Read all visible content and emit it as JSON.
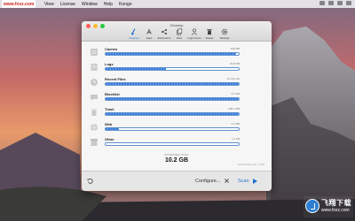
{
  "watermark_top": "www.fxxz.com",
  "menubar": {
    "items": [
      "View",
      "License",
      "Window",
      "Help",
      "Kongo"
    ]
  },
  "window": {
    "title": "Cleanup",
    "toolbar": [
      {
        "label": "Cleanup",
        "icon": "broom-icon",
        "active": true
      },
      {
        "label": "Apps",
        "icon": "apps-icon",
        "active": false
      },
      {
        "label": "Extensions",
        "icon": "share-icon",
        "active": false
      },
      {
        "label": "Files",
        "icon": "files-icon",
        "active": false
      },
      {
        "label": "Login Items",
        "icon": "person-icon",
        "active": false
      },
      {
        "label": "Eraser",
        "icon": "trash-icon",
        "active": false
      },
      {
        "label": "Settings",
        "icon": "gear-icon",
        "active": false
      }
    ],
    "items": [
      {
        "name": "Caches",
        "size": "338 MB",
        "progress": 0.98
      },
      {
        "name": "Logs",
        "size": "32.8 MB",
        "progress": 0.45
      },
      {
        "name": "Recent Files",
        "size": "31 records",
        "progress": 1.0
      },
      {
        "name": "Blocklist",
        "size": "5.2 GB",
        "progress": 1.0
      },
      {
        "name": "Trash",
        "size": "238.1 MB",
        "progress": 1.0
      },
      {
        "name": "Web",
        "size": "3.7 MB",
        "progress": 0.1
      },
      {
        "name": "Other",
        "size": "2.1 KB",
        "progress": 0.0
      }
    ],
    "estimate": {
      "label": "ESTIMATED TOTAL",
      "value": "10.2 GB",
      "last_run": "Last Run Scan Jan 7, 2015"
    },
    "bottom": {
      "configure_label": "Configure...",
      "scan_label": "Scan"
    }
  },
  "badge": {
    "name": "飞翔下载",
    "url": "www.fxxz.com"
  },
  "colors": {
    "accent": "#1f6fd0",
    "bar_fill": "#3a7bd8"
  }
}
